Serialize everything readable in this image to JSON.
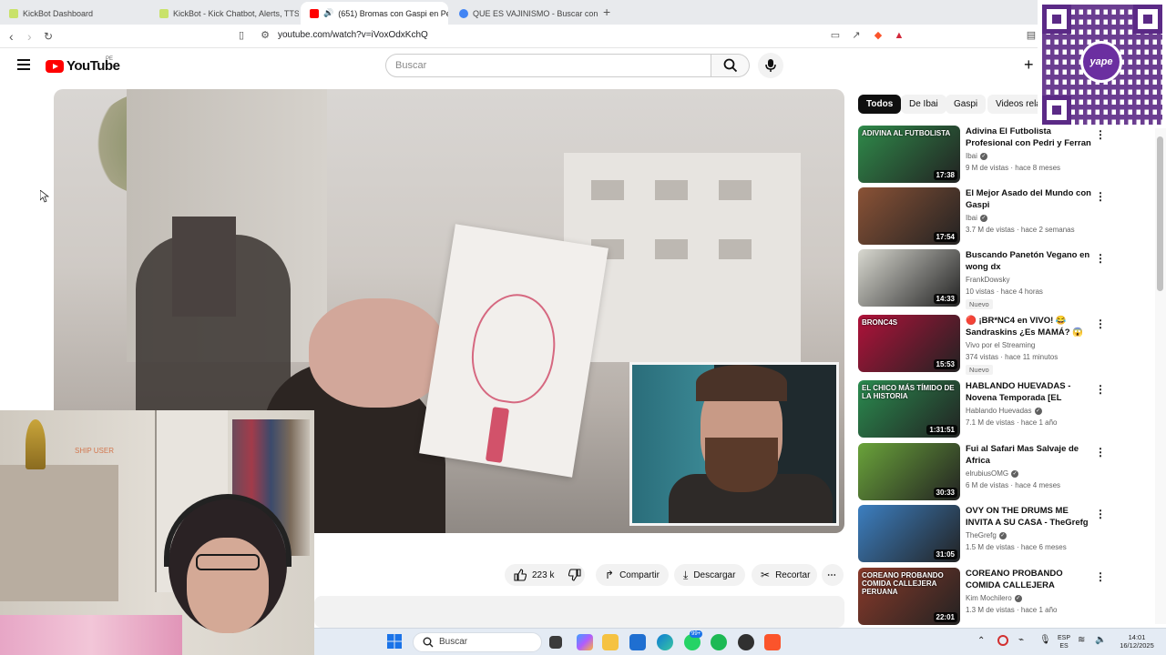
{
  "browser": {
    "tabs": [
      {
        "label": "KickBot Dashboard",
        "color": "#c9e26a"
      },
      {
        "label": "KickBot - Kick Chatbot, Alerts, TTS, C",
        "color": "#c9e26a"
      },
      {
        "label": "(651) Bromas con Gaspi en Pe",
        "color": "#ff0000",
        "active": true
      },
      {
        "label": "QUE ES VAJINISMO - Buscar con Goo",
        "color": "#4285f4"
      }
    ],
    "url": "youtube.com/watch?v=iVoxOdxKchQ"
  },
  "youtube": {
    "logo_text": "YouTube",
    "country": "PE",
    "search_placeholder": "Buscar",
    "chips": [
      "Todos",
      "De Ibai",
      "Gaspi",
      "Videos rela"
    ],
    "actions": {
      "likes": "223 k",
      "share": "Compartir",
      "download": "Descargar",
      "clip": "Recortar"
    },
    "webcam_overlay_text": "SHIP USER",
    "recommendations": [
      {
        "title": "Adivina El Futbolista Profesional con Pedri y Ferran ...",
        "channel": "Ibai",
        "verified": true,
        "meta": "9 M de vistas · hace 8 meses",
        "duration": "17:38",
        "thumb_color": "#2f8a4a",
        "thumb_text": "ADIVINA AL FUTBOLISTA"
      },
      {
        "title": "El Mejor Asado del Mundo con Gaspi",
        "channel": "Ibai",
        "verified": true,
        "meta": "3.7 M de vistas · hace 2 semanas",
        "duration": "17:54",
        "thumb_color": "#8a5236",
        "thumb_text": ""
      },
      {
        "title": "Buscando Panetón Vegano en wong dx",
        "channel": "FrankDowsky",
        "verified": false,
        "meta": "10 vistas · hace 4 horas",
        "duration": "14:33",
        "badge": "Nuevo",
        "thumb_color": "#d8d8d0",
        "thumb_text": ""
      },
      {
        "title": "🔴 ¡BR*NC4 en VIVO! 😂 Sandraskins ¿Es MAMÁ? 😱 |...",
        "channel": "Vivo por el Streaming",
        "verified": false,
        "meta": "374 vistas · hace 11 minutos",
        "duration": "15:53",
        "badge": "Nuevo",
        "thumb_color": "#b0123a",
        "thumb_text": "BRONC4S"
      },
      {
        "title": "HABLANDO HUEVADAS - Novena Temporada [EL CHICO...",
        "channel": "Hablando Huevadas",
        "verified": true,
        "meta": "7.1 M de vistas · hace 1 año",
        "duration": "1:31:51",
        "thumb_color": "#2a8b4f",
        "thumb_text": "EL CHICO MÁS TÍMIDO DE LA HISTORIA"
      },
      {
        "title": "Fui al Safari Mas Salvaje de Africa",
        "channel": "elrubiusOMG",
        "verified": true,
        "meta": "6 M de vistas · hace 4 meses",
        "duration": "30:33",
        "thumb_color": "#6aa33a",
        "thumb_text": ""
      },
      {
        "title": "OVY ON THE DRUMS ME INVITA A SU CASA - TheGrefg",
        "channel": "TheGrefg",
        "verified": true,
        "meta": "1.5 M de vistas · hace 6 meses",
        "duration": "31:05",
        "thumb_color": "#3c7fc1",
        "thumb_text": ""
      },
      {
        "title": "COREANO PROBANDO COMIDA CALLEJERA PERUANA EN ...",
        "channel": "Kim Mochilero",
        "verified": true,
        "meta": "1.3 M de vistas · hace 1 año",
        "duration": "22:01",
        "thumb_color": "#8a3a2a",
        "thumb_text": "COREANO PROBANDO COMIDA CALLEJERA PERUANA"
      }
    ]
  },
  "qr_overlay": {
    "brand": "yape",
    "color": "#5b2a86"
  },
  "taskbar": {
    "search_placeholder": "Buscar",
    "notification_count": "99+",
    "lang_top": "ESP",
    "lang_bottom": "ES",
    "time": "14:01",
    "date": "16/12/2025"
  }
}
